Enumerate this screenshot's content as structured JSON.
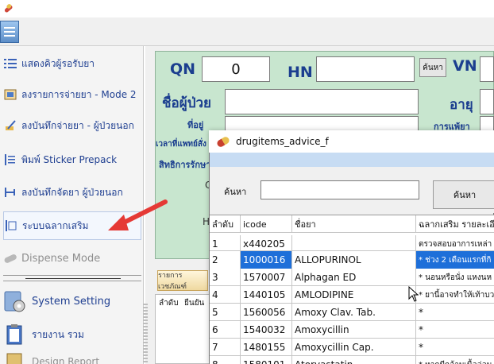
{
  "toolbar": {
    "menu_icon": "menu-lines-icon"
  },
  "sidebar": {
    "items": [
      {
        "label": "แสดงคิวผู้รอรับยา",
        "icon": "queue-list-icon"
      },
      {
        "label": "ลงรายการจ่ายยา - Mode 2",
        "icon": "drug-form-icon"
      },
      {
        "label": "ลงบันทึกจ่ายยา - ผู้ป่วยนอก",
        "icon": "pen-icon"
      },
      {
        "label": "พิมพ์ Sticker Prepack",
        "icon": "list-icon"
      },
      {
        "label": "ลงบันทึกจัดยา ผู้ป่วยนอก",
        "icon": "dispense-icon"
      },
      {
        "label": "ระบบฉลากเสริม",
        "icon": "label-icon"
      },
      {
        "label": "Dispense Mode",
        "icon": "pill-grey-icon"
      },
      {
        "label": "System Setting",
        "icon": "settings-gear-icon"
      },
      {
        "label": "รายงาน รวม",
        "icon": "clipboard-icon"
      },
      {
        "label": "Design Report",
        "icon": "design-report-icon"
      }
    ]
  },
  "main": {
    "qn_label": "QN",
    "qn_value": "0",
    "hn_label": "HN",
    "search_btn": "ค้นหา",
    "vn_label": "VN",
    "patient_name_label": "ชื่อผู้ป่วย",
    "age_label": "อายุ",
    "address_label": "ที่อยู่",
    "allergy_label": "การแพ้ยา",
    "doctor_time_label": "เวลาที่แพทย์สั่ง",
    "right_label": "สิทธิการรักษา",
    "lower_tab": "รายการเวชภัณฑ์",
    "lower_cols": [
      "ลำดับ",
      "ยืนยัน"
    ]
  },
  "dialog": {
    "title": "drugitems_advice_f",
    "search_label": "ค้นหา",
    "search_value": "",
    "search_button": "ค้นหา",
    "columns": [
      "ลำดับ",
      "icode",
      "ชื่อยา",
      "ฉลากเสริม รายละเอีย"
    ],
    "rows": [
      {
        "no": "1",
        "icode": "x440205",
        "name": "",
        "advice": "ตรวจสอบอาการเหล่า"
      },
      {
        "no": "2",
        "icode": "1000016",
        "name": "ALLOPURINOL",
        "advice": "* ช่วง 2 เดือนแรกที่กิ",
        "selected": true
      },
      {
        "no": "3",
        "icode": "1570007",
        "name": "Alphagan ED",
        "advice": "* นอนหรือนั่ง แหงนห"
      },
      {
        "no": "4",
        "icode": "1440105",
        "name": "AMLODIPINE",
        "advice": "* ยานี้อาจทำให้เท้าบว"
      },
      {
        "no": "5",
        "icode": "1560056",
        "name": "Amoxy Clav. Tab.",
        "advice": "*"
      },
      {
        "no": "6",
        "icode": "1540032",
        "name": "Amoxycillin",
        "advice": "*"
      },
      {
        "no": "7",
        "icode": "1480155",
        "name": "Amoxycillin Cap.",
        "advice": "*"
      },
      {
        "no": "8",
        "icode": "1580101",
        "name": "Atorvastatin",
        "advice": "* หากมีกล้ามเนื้ออ่อน"
      }
    ]
  },
  "colors": {
    "accent": "#1e6fd9",
    "panel": "#c8e6cf",
    "label_blue": "#1b3e8f",
    "arrow": "#e53935"
  }
}
